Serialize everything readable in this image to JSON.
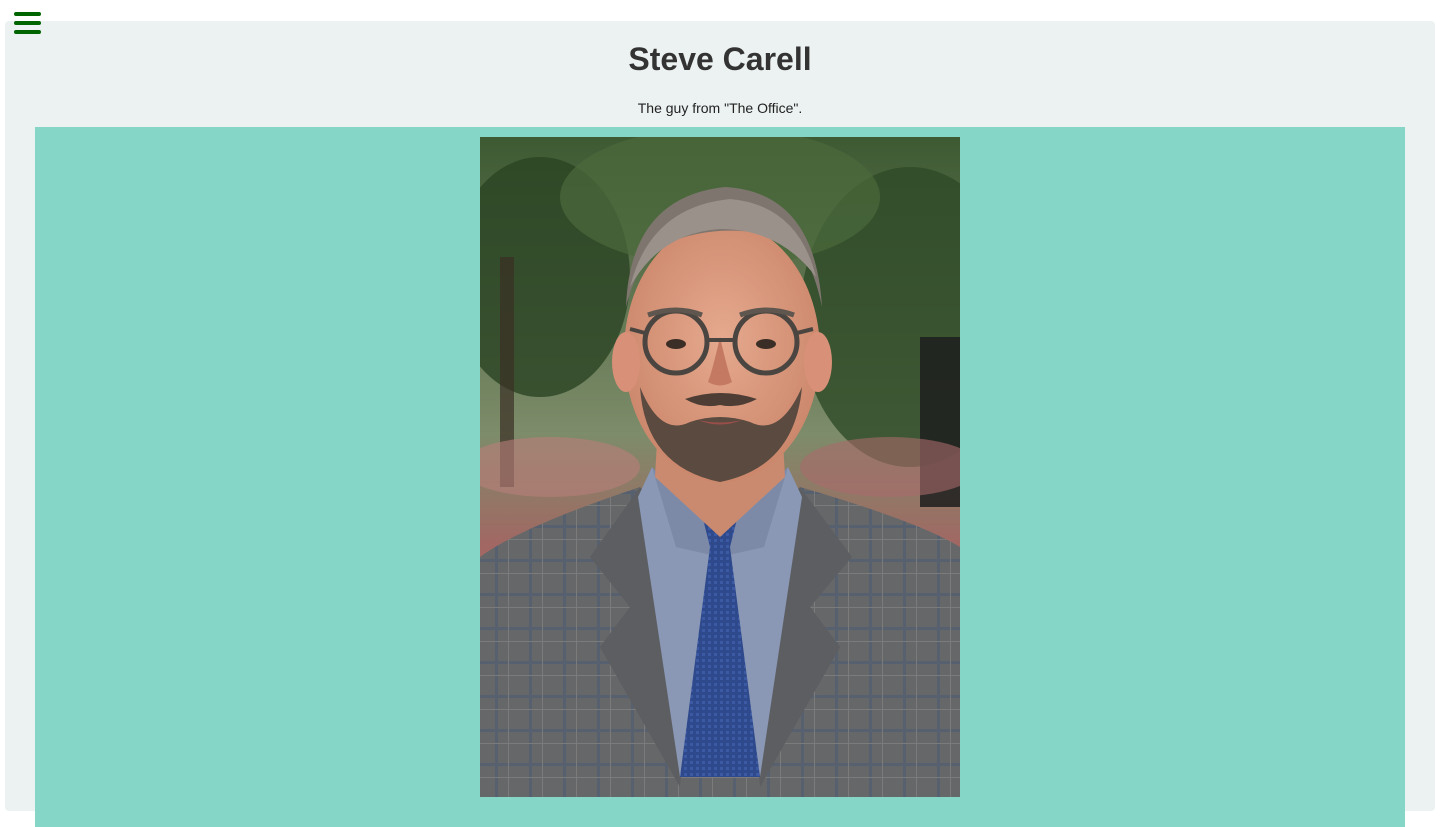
{
  "menu": {
    "icon": "hamburger-menu-icon"
  },
  "header": {
    "title": "Steve Carell",
    "subtitle": "The guy from \"The Office\"."
  },
  "image": {
    "alt": "Steve Carell",
    "panel_color": "#85d6c7"
  },
  "colors": {
    "accent": "#006400",
    "card_background": "#ecf2f1",
    "title_text": "#333333"
  }
}
